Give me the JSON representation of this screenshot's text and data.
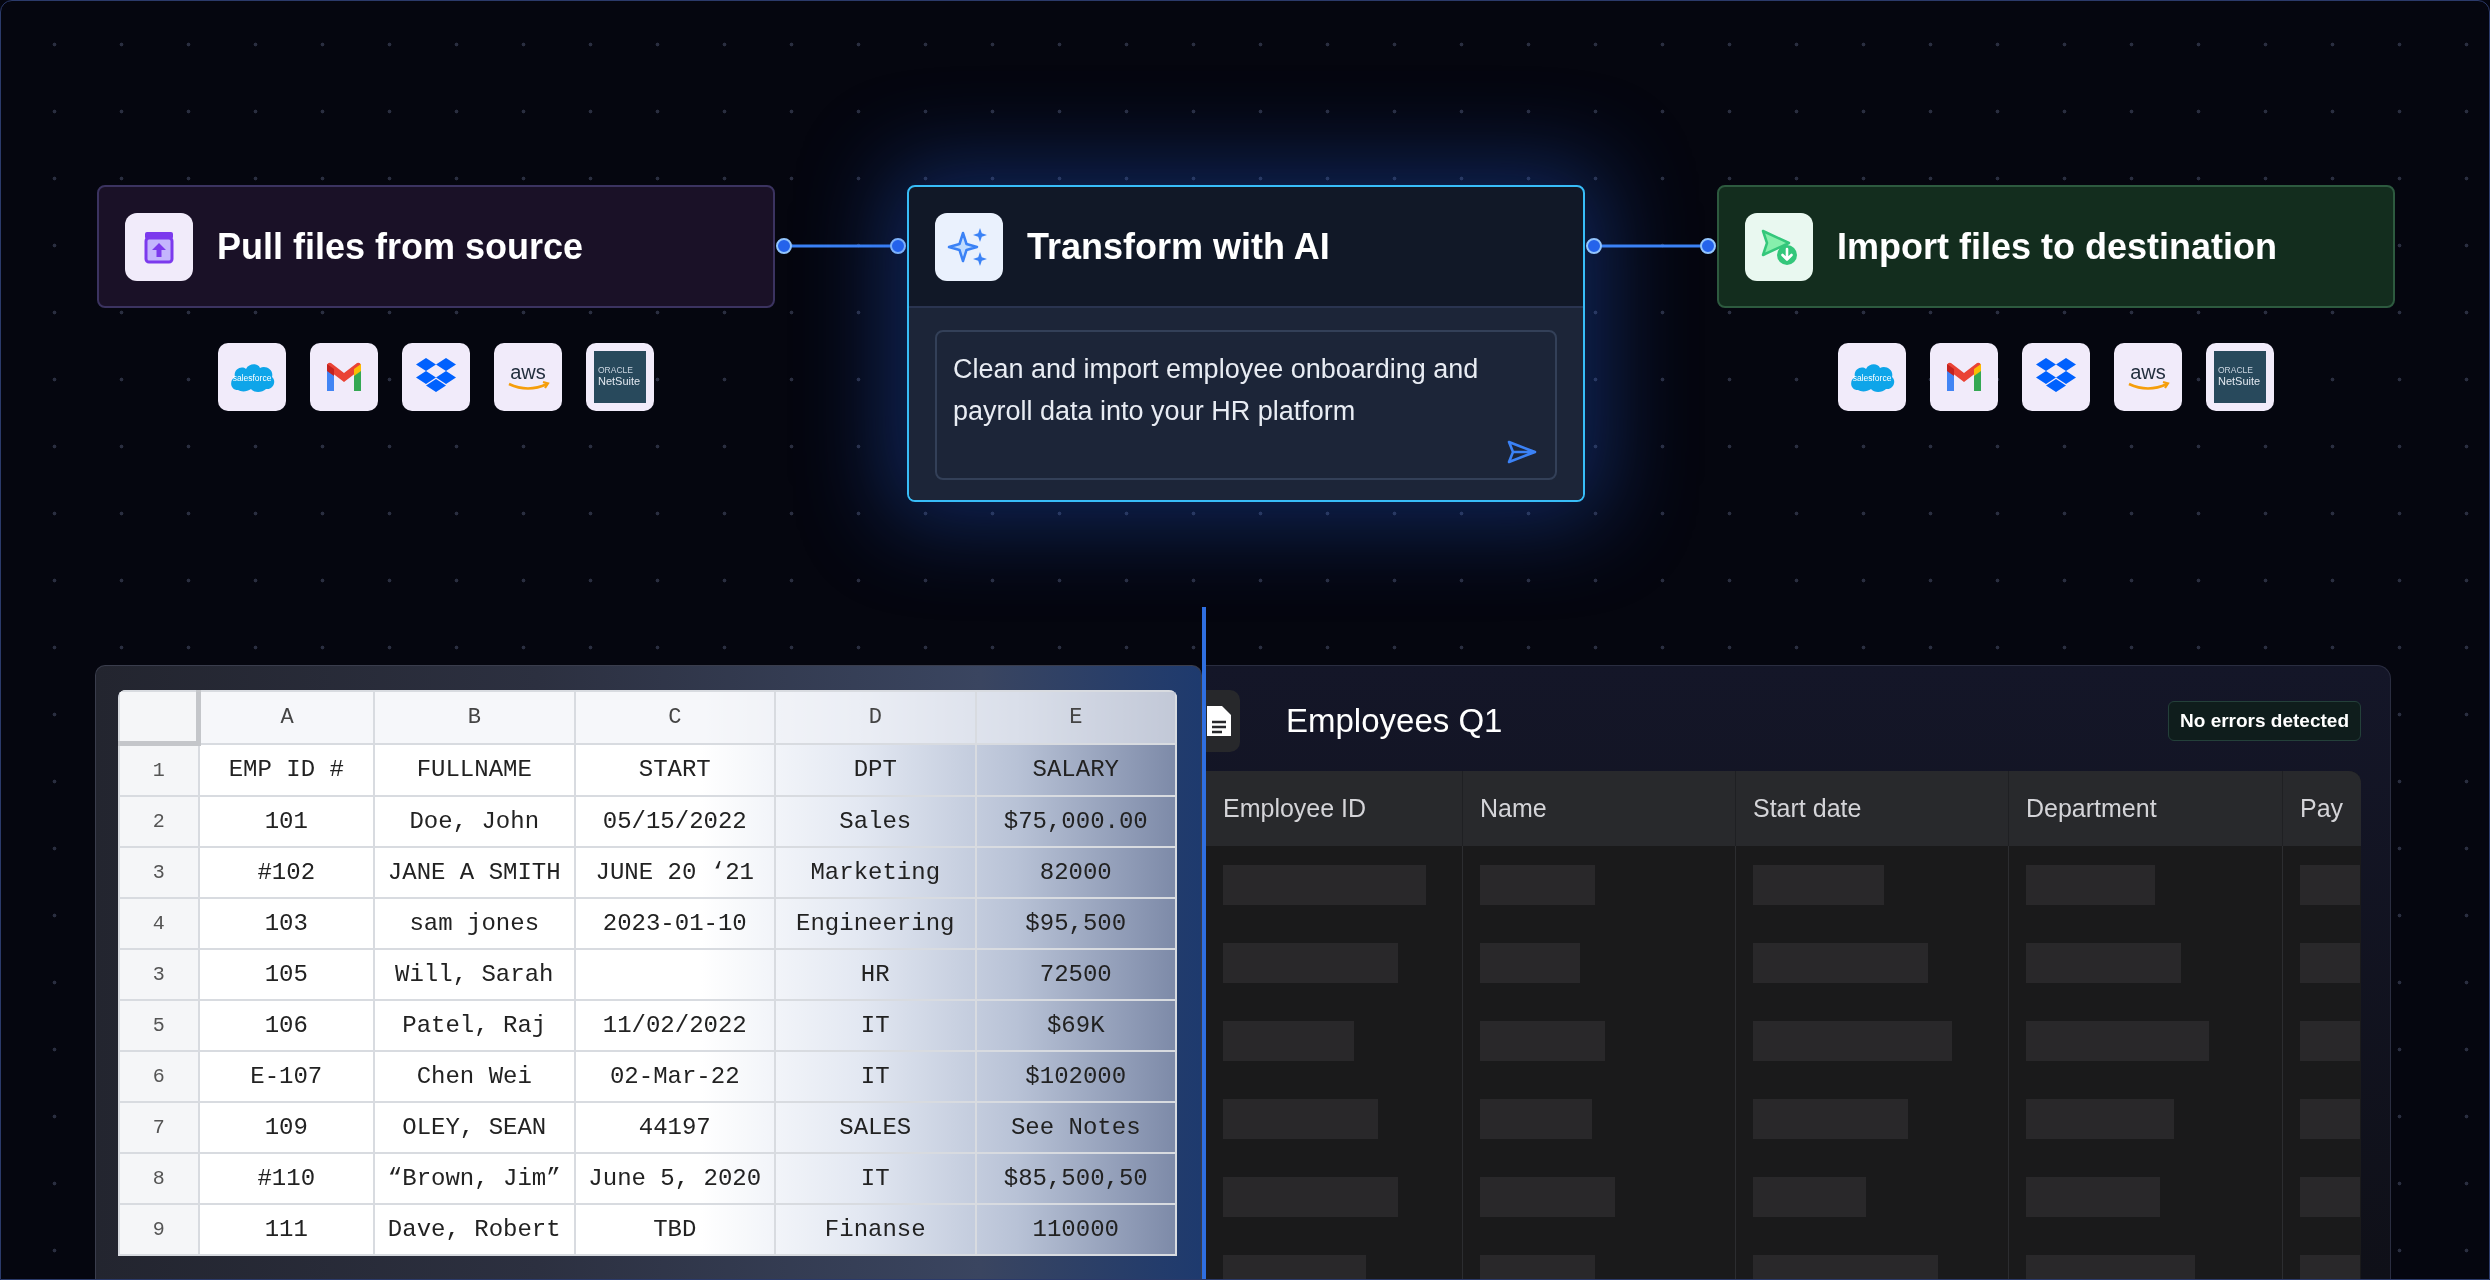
{
  "flow": {
    "nodes": [
      {
        "kind": "source",
        "title": "Pull files from source",
        "logos": [
          {
            "kind": "salesforce",
            "text": "salesforce"
          },
          {
            "kind": "gmail"
          },
          {
            "kind": "dropbox"
          },
          {
            "kind": "aws",
            "text": "aws"
          },
          {
            "kind": "netsuite",
            "text": "NetSuite",
            "subtext": "ORACLE"
          }
        ]
      },
      {
        "kind": "ai",
        "title": "Transform with AI",
        "prompt": "Clean and import employee onboarding and payroll data into your HR platform"
      },
      {
        "kind": "destination",
        "title": "Import files to destination",
        "logos": [
          {
            "kind": "salesforce",
            "text": "salesforce"
          },
          {
            "kind": "gmail"
          },
          {
            "kind": "dropbox"
          },
          {
            "kind": "aws",
            "text": "aws"
          },
          {
            "kind": "netsuite",
            "text": "NetSuite",
            "subtext": "ORACLE"
          }
        ]
      }
    ]
  },
  "spreadsheet": {
    "columns": [
      "A",
      "B",
      "C",
      "D",
      "E"
    ],
    "rows": [
      {
        "number": "1",
        "cells": [
          "EMP ID #",
          "FULLNAME",
          "START",
          "DPT",
          "SALARY"
        ]
      },
      {
        "number": "2",
        "cells": [
          "101",
          "Doe, John",
          "05/15/2022",
          "Sales",
          "$75,000.00"
        ]
      },
      {
        "number": "3",
        "cells": [
          "#102",
          "JANE A SMITH",
          "JUNE 20 ‘21",
          "Marketing",
          "82000"
        ]
      },
      {
        "number": "4",
        "cells": [
          "103",
          "sam jones",
          "2023-01-10",
          "Engineering",
          "$95,500"
        ]
      },
      {
        "number": "3",
        "cells": [
          "105",
          "Will, Sarah",
          "",
          "HR",
          "72500"
        ]
      },
      {
        "number": "5",
        "cells": [
          "106",
          "Patel, Raj",
          "11/02/2022",
          "IT",
          "$69K"
        ]
      },
      {
        "number": "6",
        "cells": [
          "E-107",
          "Chen Wei",
          "02-Mar-22",
          "IT",
          "$102000"
        ]
      },
      {
        "number": "7",
        "cells": [
          "109",
          "OLEY, SEAN",
          "44197",
          "SALES",
          "See Notes"
        ]
      },
      {
        "number": "8",
        "cells": [
          "#110",
          "“Brown, Jim”",
          "June 5, 2020",
          "IT",
          "$85,500,50"
        ]
      },
      {
        "number": "9",
        "cells": [
          "111",
          "Dave, Robert",
          "TBD",
          "Finanse",
          "110000"
        ]
      }
    ]
  },
  "import_panel": {
    "title": "Employees Q1",
    "status": "No errors detected",
    "columns": [
      "Employee ID",
      "Name",
      "Start date",
      "Department",
      "Pay"
    ]
  }
}
